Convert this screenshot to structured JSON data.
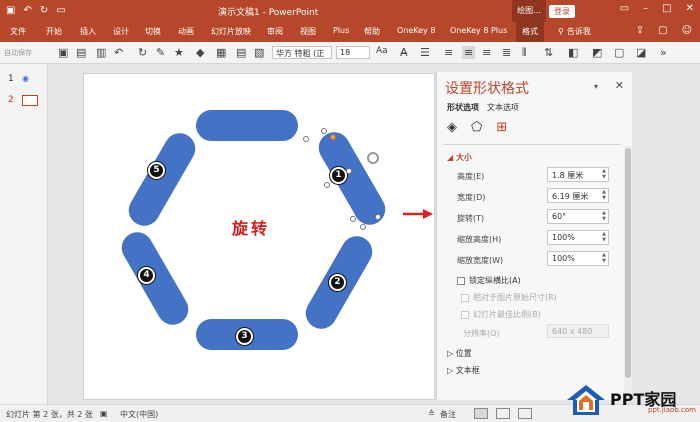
{
  "app": {
    "window_title": "演示文稿1 - PowerPoint",
    "context_group": "绘图...",
    "login_button": "登录"
  },
  "ribbon": {
    "tabs": [
      "文件",
      "开始",
      "插入",
      "设计",
      "切换",
      "动画",
      "幻灯片放映",
      "审阅",
      "视图",
      "Plus",
      "帮助",
      "OneKey 8",
      "OneKey 8 Plus",
      "格式"
    ],
    "active_tab": "格式",
    "tell_me": "告诉我"
  },
  "toolbar": {
    "autosave": "自动保存",
    "font_name": "华方 特粗 (正",
    "font_size": "18",
    "font_grow": "Aa"
  },
  "thumbnails": [
    {
      "number": "1",
      "active": false
    },
    {
      "number": "2",
      "active": true
    }
  ],
  "slide": {
    "center_text": "旋转",
    "badges": [
      "1",
      "2",
      "3",
      "4",
      "5"
    ]
  },
  "format_pane": {
    "title": "设置形状格式",
    "tabs": [
      "形状选项",
      "文本选项"
    ],
    "active_tab": "形状选项",
    "icons": [
      "fill-line-icon",
      "effects-icon",
      "size-properties-icon"
    ],
    "section_size": "大小",
    "fields": {
      "height": {
        "label": "高度(E)",
        "value": "1.8 厘米"
      },
      "width": {
        "label": "宽度(D)",
        "value": "6.19 厘米"
      },
      "rotation": {
        "label": "旋转(T)",
        "value": "60°"
      },
      "scale_height": {
        "label": "缩放高度(H)",
        "value": "100%"
      },
      "scale_width": {
        "label": "缩放宽度(W)",
        "value": "100%"
      }
    },
    "checkboxes": {
      "lock_aspect": "锁定纵横比(A)",
      "relative_original": "相对于图片原始尺寸(R)",
      "best_scale": "幻灯片最佳比例(B)"
    },
    "resolution_label": "分辨率(O)",
    "resolution_value": "640 x 480",
    "section_position": "位置",
    "section_textbox": "文本框"
  },
  "statusbar": {
    "slide_info": "幻灯片 第 2 张，共 2 张",
    "language": "中文(中国)",
    "notes": "备注"
  },
  "watermark": {
    "brand": "PPT家园",
    "url": "ppt.jiaob.com"
  },
  "colors": {
    "brand": "#b7472a",
    "shape_fill": "#4472c4",
    "arrow": "#e02020",
    "center_text": "#d21e1e"
  }
}
